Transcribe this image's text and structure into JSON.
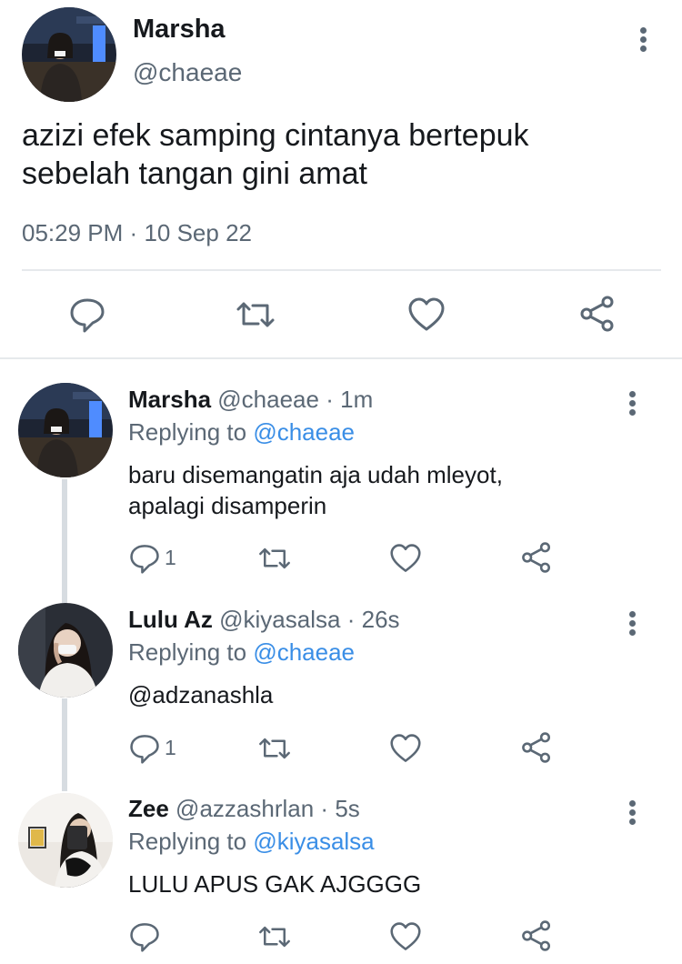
{
  "tweet": {
    "name": "Marsha",
    "handle": "@chaeae",
    "text_line1": "azizi efek samping cintanya bertepuk",
    "text_line2": "sebelah tangan gini amat",
    "time": "05:29 PM",
    "separator": "·",
    "date": "10 Sep 22"
  },
  "replies": [
    {
      "name": "Marsha",
      "handle": "@chaeae",
      "time": "1m",
      "replying_prefix": "Replying to",
      "replying_to": "@chaeae",
      "text_line1": "baru disemangatin aja udah mleyot,",
      "text_line2": "apalagi disamperin",
      "reply_count": "1"
    },
    {
      "name": "Lulu Az",
      "handle": "@kiyasalsa",
      "time": "26s",
      "replying_prefix": "Replying to",
      "replying_to": "@chaeae",
      "mention": "@adzanashla",
      "reply_count": "1"
    },
    {
      "name": "Zee",
      "handle": "@azzashrlan",
      "time": "5s",
      "replying_prefix": "Replying to",
      "replying_to": "@kiyasalsa",
      "text_line1": "LULU APUS GAK AJGGGG",
      "reply_count": ""
    }
  ],
  "icons": [
    "reply-icon",
    "retweet-icon",
    "like-icon",
    "share-icon",
    "more-icon"
  ],
  "colors": {
    "link": "#3a8ee6",
    "muted": "#5b6875",
    "text": "#16191d",
    "divider": "#e6e9ec"
  }
}
